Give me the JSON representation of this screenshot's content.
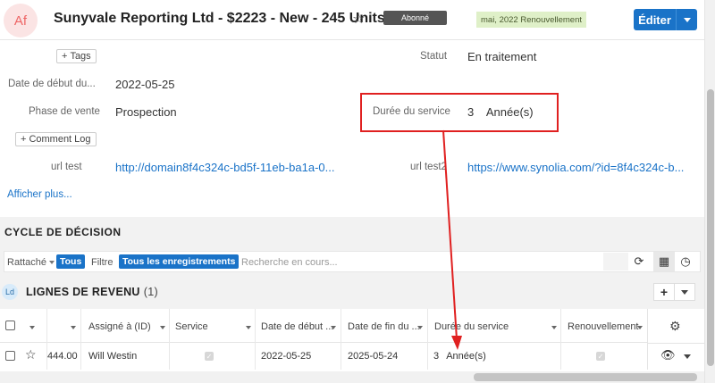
{
  "header": {
    "avatar_initials": "Af",
    "title": "Sunyvale Reporting Ltd - $2223 - New - 245 Units",
    "status_badge": "Abonné",
    "tag_badge": "mai, 2022 Renouvellement",
    "edit_label": "Éditer",
    "star_icon": "star-outline-icon"
  },
  "details": {
    "tags_button": "Tags",
    "comment_log_button": "Comment Log",
    "fields": {
      "statut": {
        "label": "Statut",
        "value": "En traitement"
      },
      "date_debut": {
        "label": "Date de début du...",
        "value": "2022-05-25"
      },
      "phase": {
        "label": "Phase de vente",
        "value": "Prospection"
      },
      "duree": {
        "label": "Durée du service",
        "value": "3",
        "unit": "Année(s)"
      },
      "url_test": {
        "label": "url test",
        "value": "http://domain8f4c324c-bd5f-11eb-ba1a-0..."
      },
      "url_test2": {
        "label": "url test2",
        "value": "https://www.synolia.com/?id=8f4c324c-b..."
      }
    },
    "show_more": "Afficher plus..."
  },
  "subpanel": {
    "section_title": "CYCLE DE DÉCISION",
    "filters": {
      "rattache_label": "Rattaché",
      "rattache_value": "Tous",
      "filtre_label": "Filtre",
      "filtre_value": "Tous les enregistrements",
      "search_placeholder": "Recherche en cours..."
    },
    "list_badge": "Ld",
    "list_title": "LIGNES DE REVENU",
    "list_count": "(1)",
    "columns": [
      "Assigné à (ID)",
      "Service",
      "Date de début ...",
      "Date de fin du ...",
      "Durée du service",
      "Renouvellement"
    ],
    "rows": [
      {
        "amount": "444.00",
        "assigned": "Will Westin",
        "service": true,
        "start": "2022-05-25",
        "end": "2025-05-24",
        "duration": "3",
        "duration_unit": "Année(s)",
        "renewal": true
      }
    ]
  },
  "colors": {
    "accent": "#1a73c8",
    "annotation_red": "#e02020",
    "tag_green_bg": "#dff0c8",
    "status_badge_bg": "#555555"
  }
}
